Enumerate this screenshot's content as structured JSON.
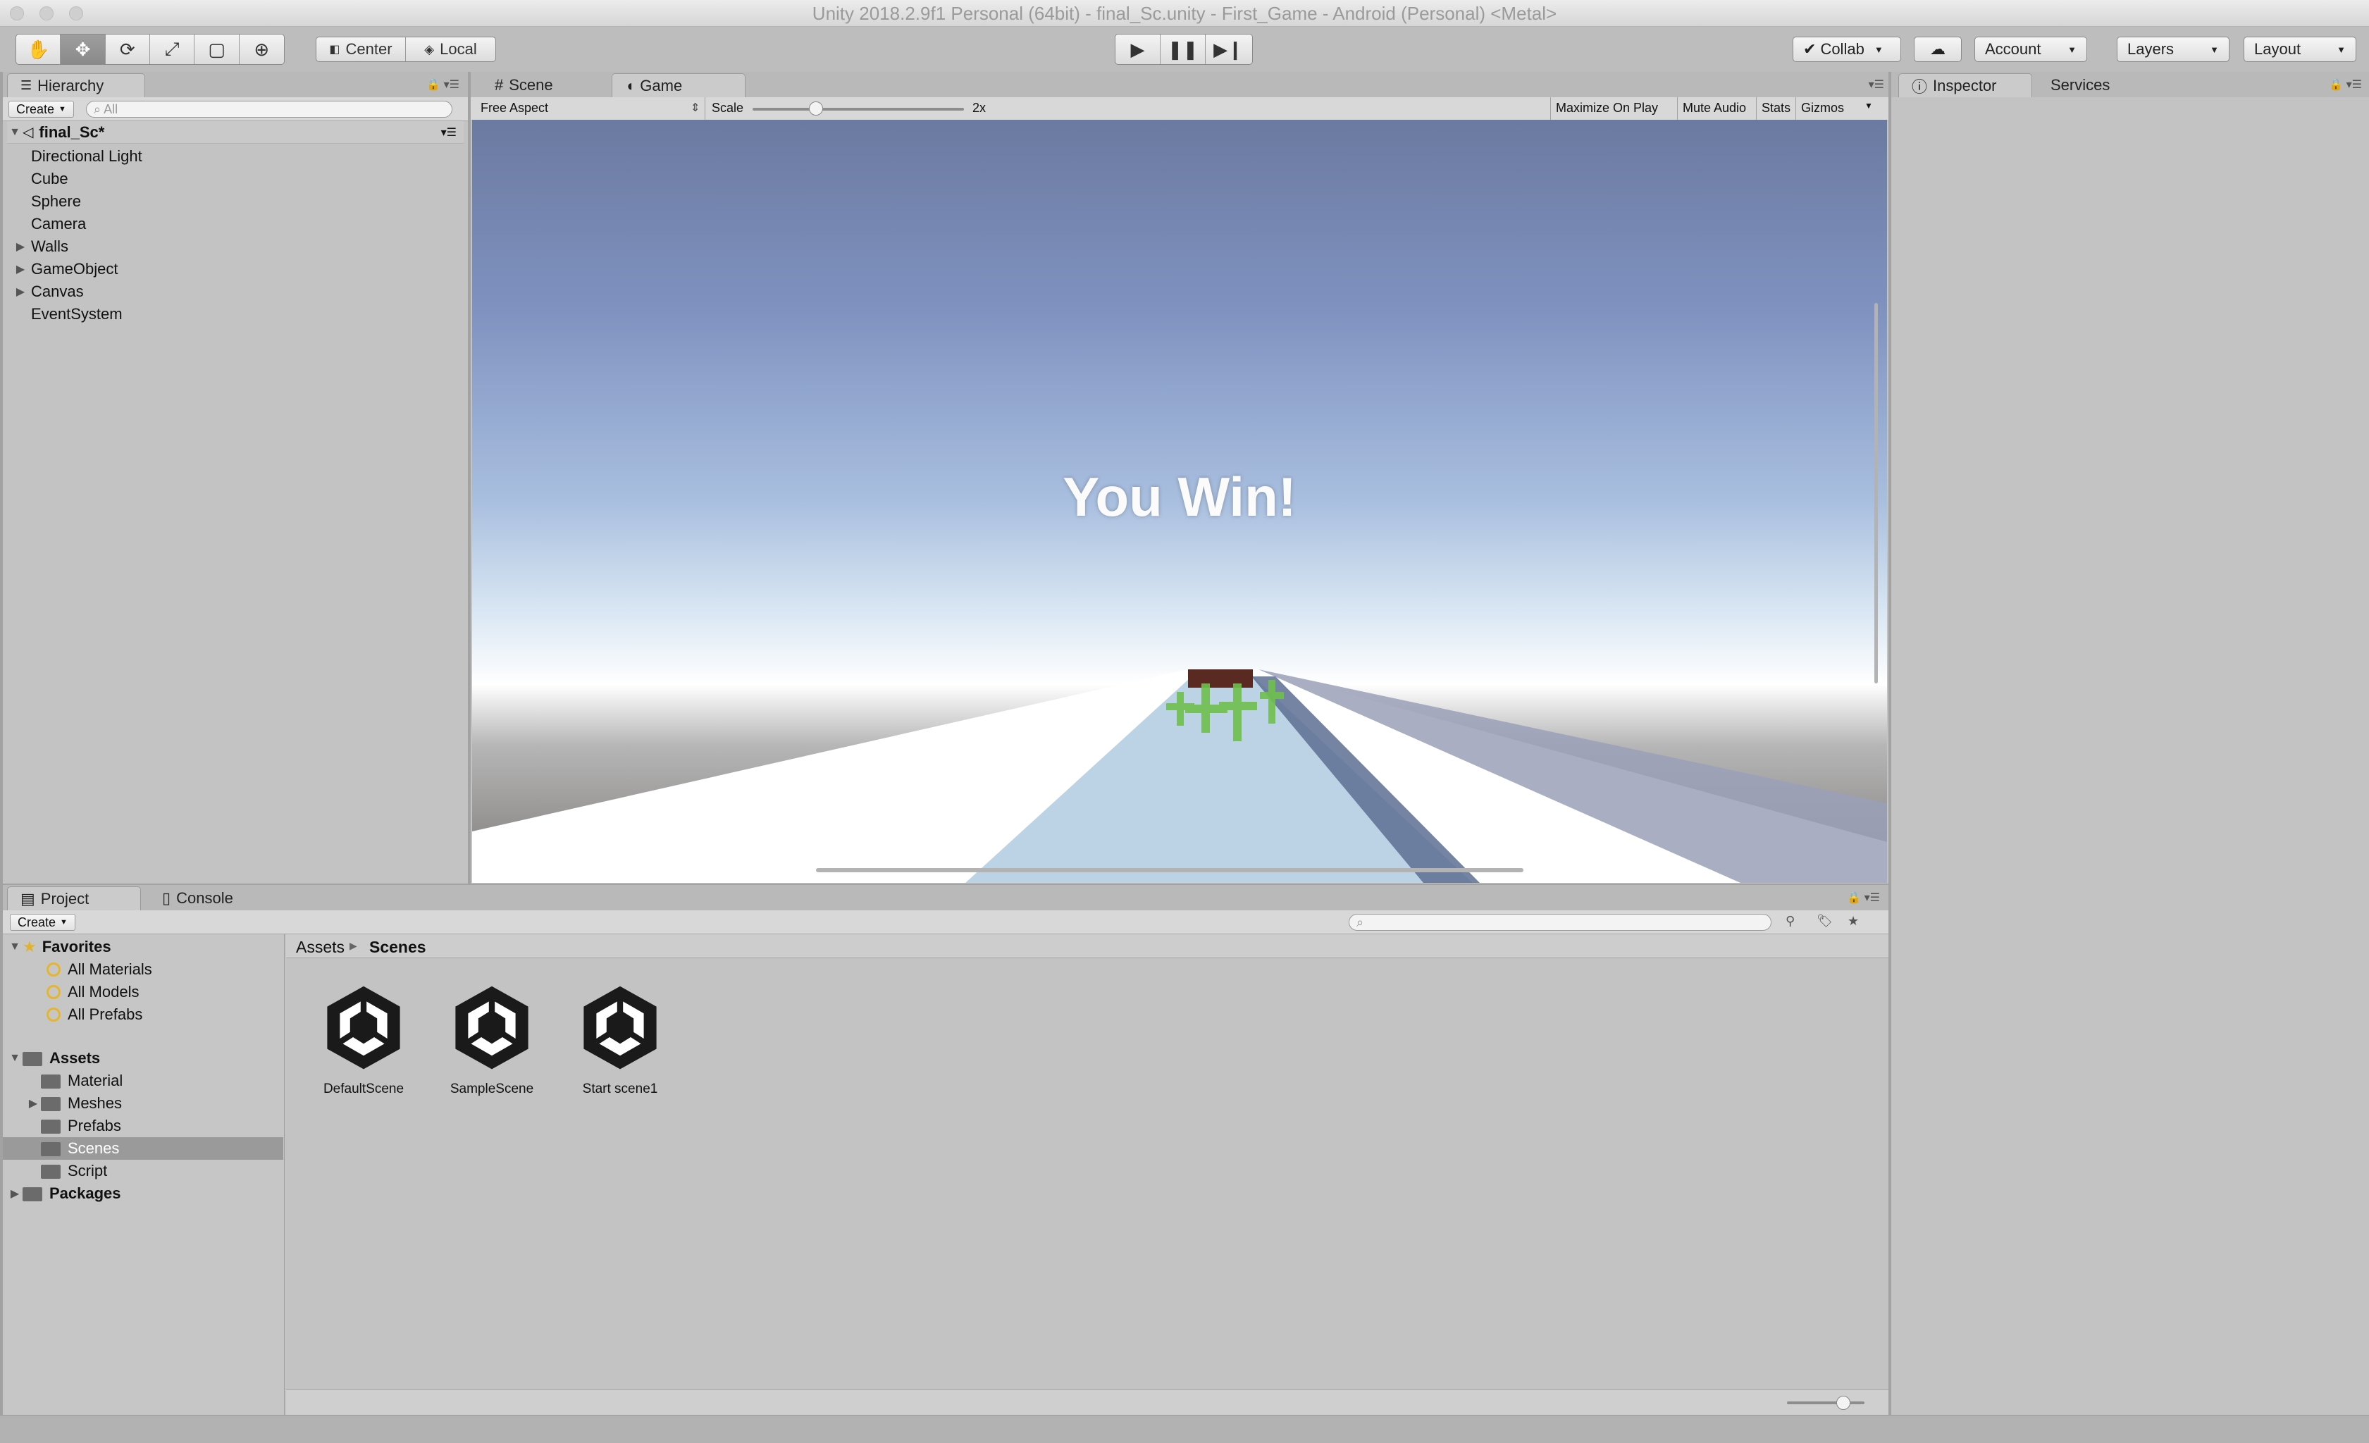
{
  "window": {
    "title": "Unity 2018.2.9f1 Personal (64bit) - final_Sc.unity - First_Game - Android (Personal) <Metal>"
  },
  "toolbar": {
    "tools": [
      "hand-icon",
      "move-icon",
      "rotate-icon",
      "scale-icon",
      "rect-icon",
      "transform-icon"
    ],
    "pivot_label": "Center",
    "space_label": "Local",
    "collab_label": "Collab",
    "account_label": "Account",
    "layers_label": "Layers",
    "layout_label": "Layout"
  },
  "hierarchy": {
    "tab_label": "Hierarchy",
    "create_label": "Create",
    "search_placeholder": "All",
    "scene_name": "final_Sc*",
    "items": [
      {
        "label": "Directional Light",
        "expandable": false
      },
      {
        "label": "Cube",
        "expandable": false
      },
      {
        "label": "Sphere",
        "expandable": false
      },
      {
        "label": "Camera",
        "expandable": false
      },
      {
        "label": "Walls",
        "expandable": true
      },
      {
        "label": "GameObject",
        "expandable": true
      },
      {
        "label": "Canvas",
        "expandable": true
      },
      {
        "label": "EventSystem",
        "expandable": false
      }
    ]
  },
  "view_tabs": {
    "scene_label": "Scene",
    "game_label": "Game"
  },
  "game_bar": {
    "aspect_label": "Free Aspect",
    "scale_label": "Scale",
    "scale_value": "2x",
    "scale_fraction": 0.3,
    "maximize_label": "Maximize On Play",
    "mute_label": "Mute Audio",
    "stats_label": "Stats",
    "gizmos_label": "Gizmos"
  },
  "game_view": {
    "message": "You Win!"
  },
  "inspector": {
    "tab_label": "Inspector",
    "services_label": "Services"
  },
  "project": {
    "tab_label": "Project",
    "console_label": "Console",
    "create_label": "Create",
    "favorites_label": "Favorites",
    "favorites": [
      "All Materials",
      "All Models",
      "All Prefabs"
    ],
    "assets_label": "Assets",
    "asset_folders": [
      {
        "label": "Material",
        "expandable": false,
        "selected": false
      },
      {
        "label": "Meshes",
        "expandable": true,
        "selected": false
      },
      {
        "label": "Prefabs",
        "expandable": false,
        "selected": false
      },
      {
        "label": "Scenes",
        "expandable": false,
        "selected": true
      },
      {
        "label": "Script",
        "expandable": false,
        "selected": false
      }
    ],
    "packages_label": "Packages",
    "breadcrumb": {
      "root": "Assets",
      "current": "Scenes"
    },
    "scene_files": [
      "DefaultScene",
      "SampleScene",
      "Start scene1"
    ]
  }
}
